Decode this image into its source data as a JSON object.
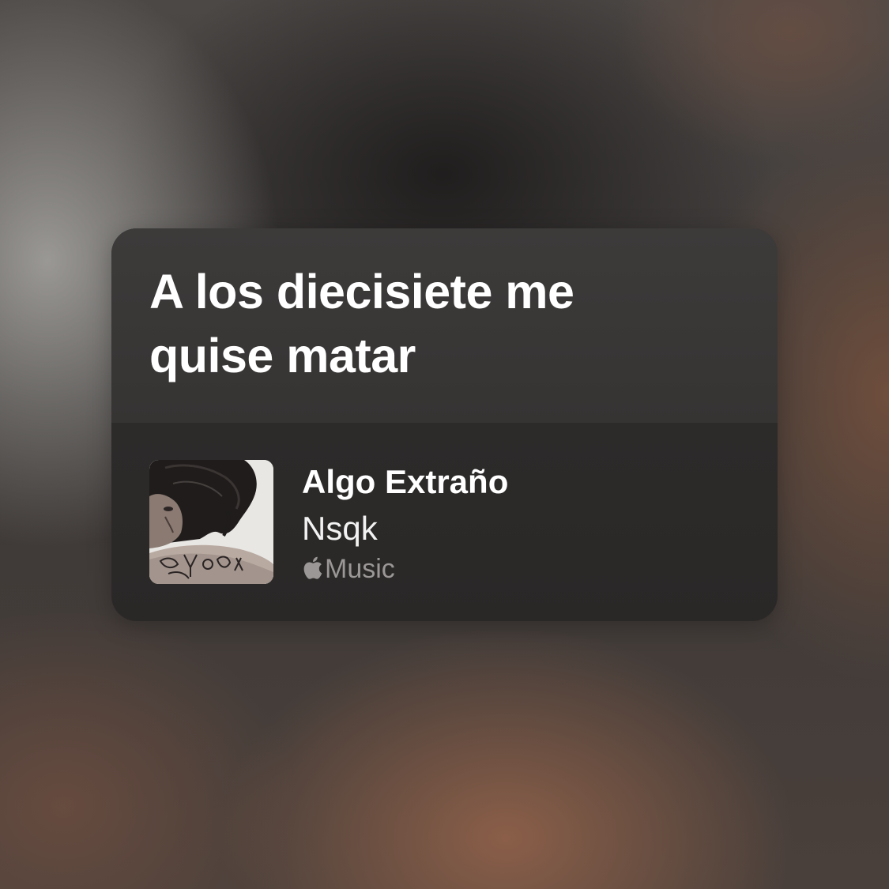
{
  "lyric": {
    "text": "A los diecisiete me\nquise matar"
  },
  "song": {
    "title": "Algo Extraño",
    "artist": "Nsqk",
    "service_label": "Music",
    "service_icon": "apple-logo-icon",
    "artwork_icon": "album-artwork"
  },
  "colors": {
    "card_top": "#3d3b3a",
    "card_bottom": "#2b2928",
    "title_text": "#ffffff",
    "service_text": "#9a9796"
  }
}
